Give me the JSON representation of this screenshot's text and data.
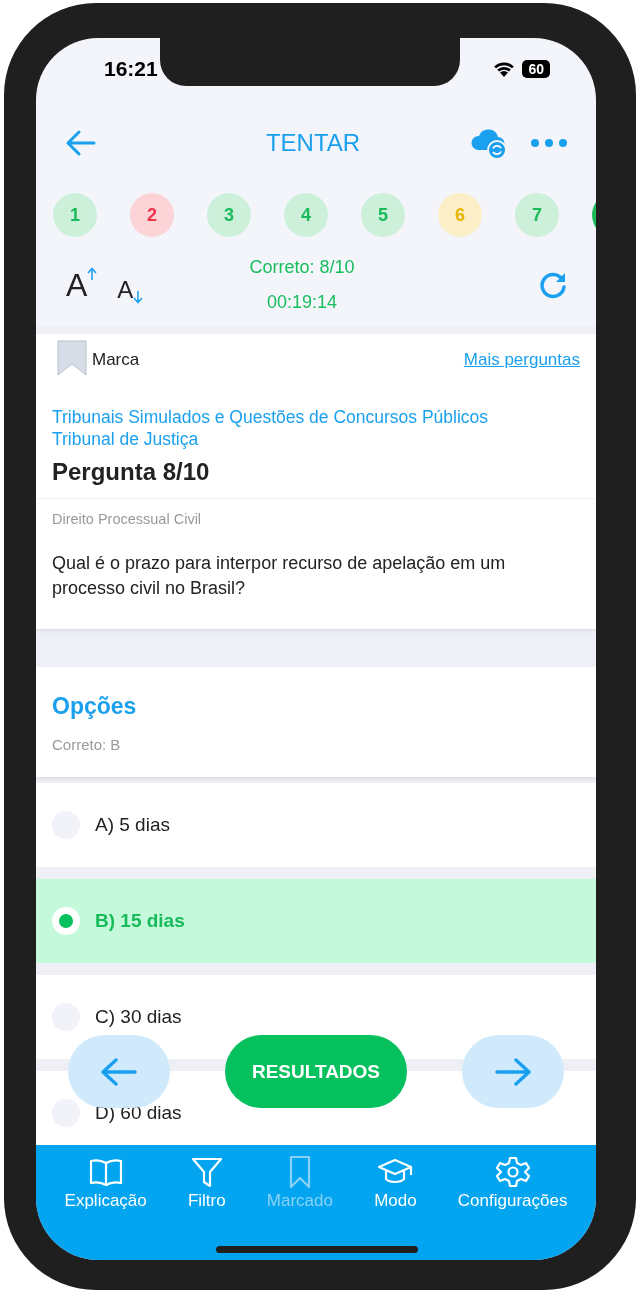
{
  "status_bar": {
    "time": "16:21",
    "battery": "60"
  },
  "header": {
    "title": "TENTAR"
  },
  "questions": [
    {
      "label": "1",
      "color": "#1bbb5b",
      "selected": false
    },
    {
      "label": "2",
      "color": "#f0354a",
      "selected": false
    },
    {
      "label": "3",
      "color": "#1bbb5b",
      "selected": false
    },
    {
      "label": "4",
      "color": "#1bbb5b",
      "selected": false
    },
    {
      "label": "5",
      "color": "#1bbb5b",
      "selected": false
    },
    {
      "label": "6",
      "color": "#e8b400",
      "selected": false
    },
    {
      "label": "7",
      "color": "#1bbb5b",
      "selected": false
    },
    {
      "color": "#1bbb5b",
      "selected": true
    }
  ],
  "font_controls": {
    "increase": "A",
    "decrease": "A"
  },
  "score": {
    "correct": "Correto: 8/10",
    "timer": "00:19:14"
  },
  "question": {
    "bookmark_label": "Marca",
    "bookmarked": false,
    "more_link": "Mais perguntas",
    "source_lines": [
      "Tribunais Simulados e Questões de Concursos Públicos",
      "Tribunal de Justiça"
    ],
    "title": "Pergunta 8/10",
    "subject": "Direito Processual Civil",
    "text": "Qual é o prazo para interpor recurso de apelação em um processo civil no Brasil?"
  },
  "options": {
    "title": "Opções",
    "answer": "Correto: B",
    "items": [
      {
        "label": "A) 5 dias",
        "selected": false
      },
      {
        "label": "B) 15 dias",
        "selected": true
      },
      {
        "label": "C) 30 dias",
        "selected": false
      },
      {
        "label": "D) 60 dias",
        "selected": false
      }
    ]
  },
  "actions": {
    "results": "RESULTADOS"
  },
  "nav": [
    {
      "label": "Explicação",
      "disabled": false
    },
    {
      "label": "Filtro",
      "disabled": false
    },
    {
      "label": "Marcado",
      "disabled": true
    },
    {
      "label": "Modo",
      "disabled": false
    },
    {
      "label": "Configurações",
      "disabled": false
    }
  ]
}
